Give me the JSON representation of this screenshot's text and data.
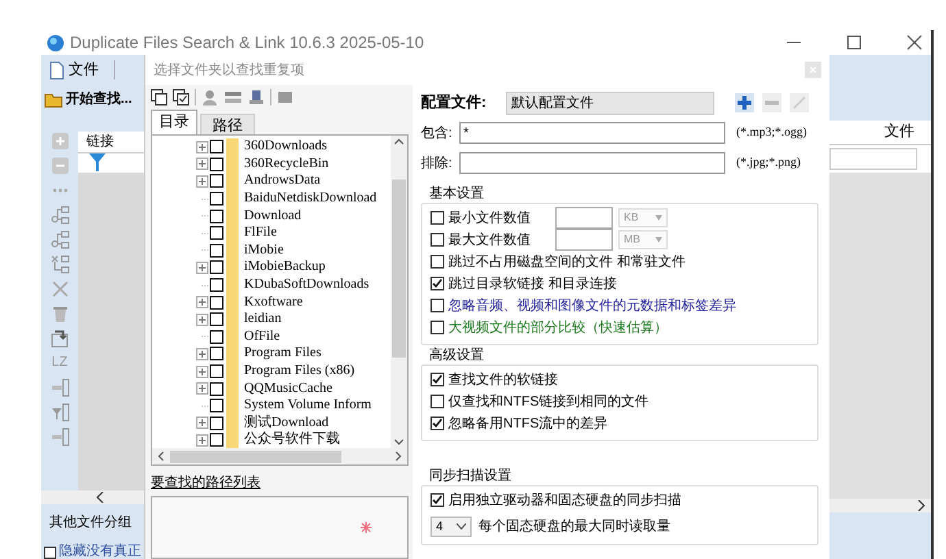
{
  "window": {
    "title": "Duplicate Files Search & Link 10.6.3 2025-05-10"
  },
  "app": {
    "file_tab": "文件",
    "start_button": "开始查找...",
    "side_toolbar_text": "LZ",
    "list_header": "链接",
    "right_header": "文件",
    "other_groups_label": "其他文件分组",
    "hide_checkbox": {
      "label": "隐藏没有真正",
      "checked": false
    }
  },
  "dialog": {
    "title": "选择文件夹以查找重复项",
    "tabs": [
      {
        "label": "目录",
        "selected": true
      },
      {
        "label": "路径",
        "selected": false
      }
    ],
    "tree": [
      {
        "name": "360Downloads",
        "expandable": true,
        "checked": false
      },
      {
        "name": "360RecycleBin",
        "expandable": true,
        "checked": false
      },
      {
        "name": "AndrowsData",
        "expandable": true,
        "checked": false
      },
      {
        "name": "BaiduNetdiskDownload",
        "expandable": false,
        "checked": false
      },
      {
        "name": "Download",
        "expandable": false,
        "checked": false
      },
      {
        "name": "FlFile",
        "expandable": false,
        "checked": false
      },
      {
        "name": "iMobie",
        "expandable": false,
        "checked": false
      },
      {
        "name": "iMobieBackup",
        "expandable": true,
        "checked": false
      },
      {
        "name": "KDubaSoftDownloads",
        "expandable": false,
        "checked": false
      },
      {
        "name": "Kxoftware",
        "expandable": true,
        "checked": false
      },
      {
        "name": "leidian",
        "expandable": true,
        "checked": false
      },
      {
        "name": "OfFile",
        "expandable": false,
        "checked": false
      },
      {
        "name": "Program Files",
        "expandable": true,
        "checked": false
      },
      {
        "name": "Program Files (x86)",
        "expandable": true,
        "checked": false
      },
      {
        "name": "QQMusicCache",
        "expandable": true,
        "checked": false
      },
      {
        "name": "System Volume Inform",
        "expandable": false,
        "checked": false
      },
      {
        "name": "测试Download",
        "expandable": true,
        "checked": false
      },
      {
        "name": "公众号软件下载",
        "expandable": true,
        "checked": false
      }
    ],
    "path_list_label": "要查找的路径列表",
    "profile": {
      "label": "配置文件:",
      "value": "默认配置文件"
    },
    "include": {
      "label": "包含:",
      "value": "*",
      "hint": "(*.mp3;*.ogg)"
    },
    "exclude": {
      "label": "排除:",
      "hint": "(*.jpg;*.png)"
    },
    "groups": [
      {
        "title": "基本设置",
        "options": [
          {
            "kind": "size",
            "label": "最小文件数值",
            "checked": false,
            "unit": "KB",
            "color": "#000000"
          },
          {
            "kind": "size",
            "label": "最大文件数值",
            "checked": false,
            "unit": "MB",
            "color": "#000000"
          },
          {
            "kind": "check",
            "label": "跳过不占用磁盘空间的文件 和常驻文件",
            "checked": false,
            "color": "#000000"
          },
          {
            "kind": "check",
            "label": "跳过目录软链接 和目录连接",
            "checked": true,
            "color": "#000000"
          },
          {
            "kind": "check",
            "label": "忽略音频、视频和图像文件的元数据和标签差异",
            "checked": false,
            "color": "#1f1f9a"
          },
          {
            "kind": "check",
            "label": "大视频文件的部分比较（快速估算）",
            "checked": false,
            "color": "#1f7a1f"
          }
        ]
      },
      {
        "title": "高级设置",
        "options": [
          {
            "kind": "check",
            "label": "查找文件的软链接",
            "checked": true
          },
          {
            "kind": "check",
            "label": "仅查找和NTFS链接到相同的文件",
            "checked": false
          },
          {
            "kind": "check",
            "label": "忽略备用NTFS流中的差异",
            "checked": true
          }
        ]
      },
      {
        "title": "同步扫描设置",
        "options": [
          {
            "kind": "check",
            "label": "启用独立驱动器和固态硬盘的同步扫描",
            "checked": true
          },
          {
            "kind": "select",
            "value": "4",
            "label": "每个固态硬盘的最大同时读取量"
          }
        ]
      }
    ]
  }
}
